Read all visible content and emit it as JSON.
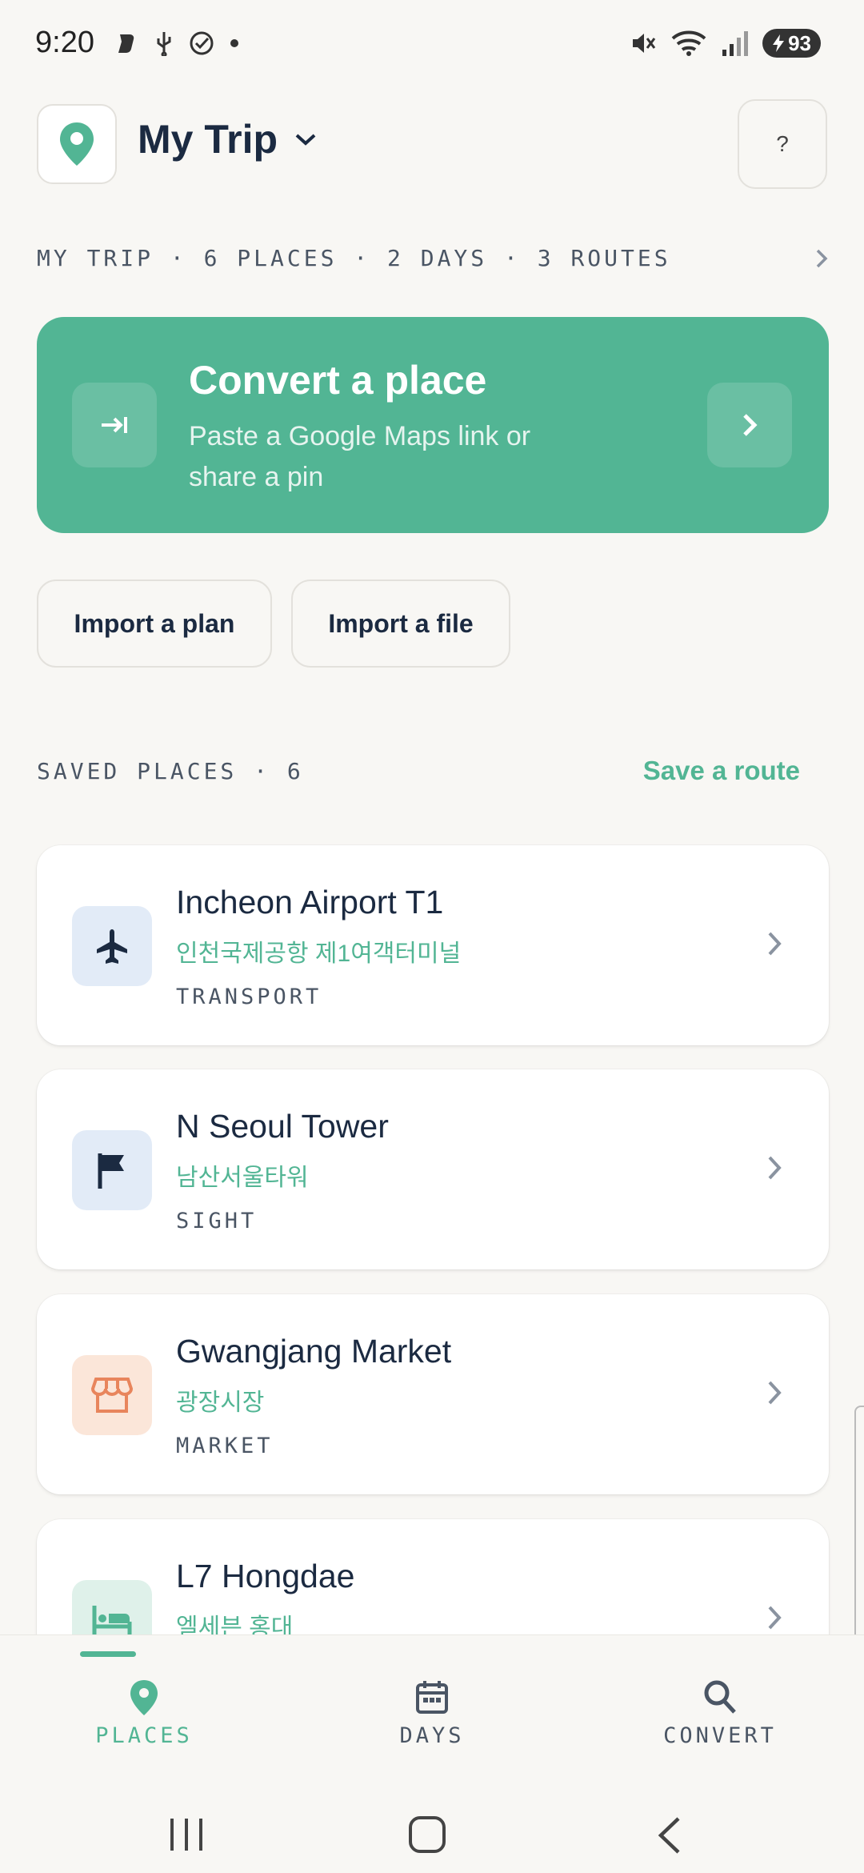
{
  "status_bar": {
    "time": "9:20",
    "battery": "93"
  },
  "header": {
    "trip_title": "My Trip",
    "help_label": "?"
  },
  "summary": {
    "text": "MY TRIP · 6 PLACES · 2 DAYS · 3 ROUTES"
  },
  "convert_card": {
    "title": "Convert a place",
    "subtitle": "Paste a Google Maps link or share a pin",
    "left_icon": "→|"
  },
  "actions": {
    "import_plan": "Import a plan",
    "import_file": "Import a file"
  },
  "saved_section": {
    "label": "SAVED PLACES · 6",
    "save_route": "Save a route"
  },
  "places": [
    {
      "name": "Incheon Airport T1",
      "local": "인천국제공항 제1여객터미널",
      "category": "TRANSPORT",
      "icon": "airplane-icon",
      "icon_bg": "#e2ebf7",
      "icon_color": "#1b2a41"
    },
    {
      "name": "N Seoul Tower",
      "local": "남산서울타워",
      "category": "SIGHT",
      "icon": "flag-icon",
      "icon_bg": "#e2ebf7",
      "icon_color": "#1b2a41"
    },
    {
      "name": "Gwangjang Market",
      "local": "광장시장",
      "category": "MARKET",
      "icon": "store-icon",
      "icon_bg": "#fbe6d9",
      "icon_color": "#e8855c"
    },
    {
      "name": "L7 Hongdae",
      "local": "엘세븐 홍대",
      "category": "",
      "icon": "bed-icon",
      "icon_bg": "#dff1ea",
      "icon_color": "#52b594"
    }
  ],
  "bottom_nav": {
    "items": [
      {
        "label": "PLACES",
        "icon": "map-pin-icon",
        "active": true
      },
      {
        "label": "DAYS",
        "icon": "calendar-icon",
        "active": false
      },
      {
        "label": "CONVERT",
        "icon": "search-icon",
        "active": false
      }
    ]
  },
  "colors": {
    "accent": "#52b594",
    "text": "#1b2a41",
    "background": "#f8f7f4"
  }
}
